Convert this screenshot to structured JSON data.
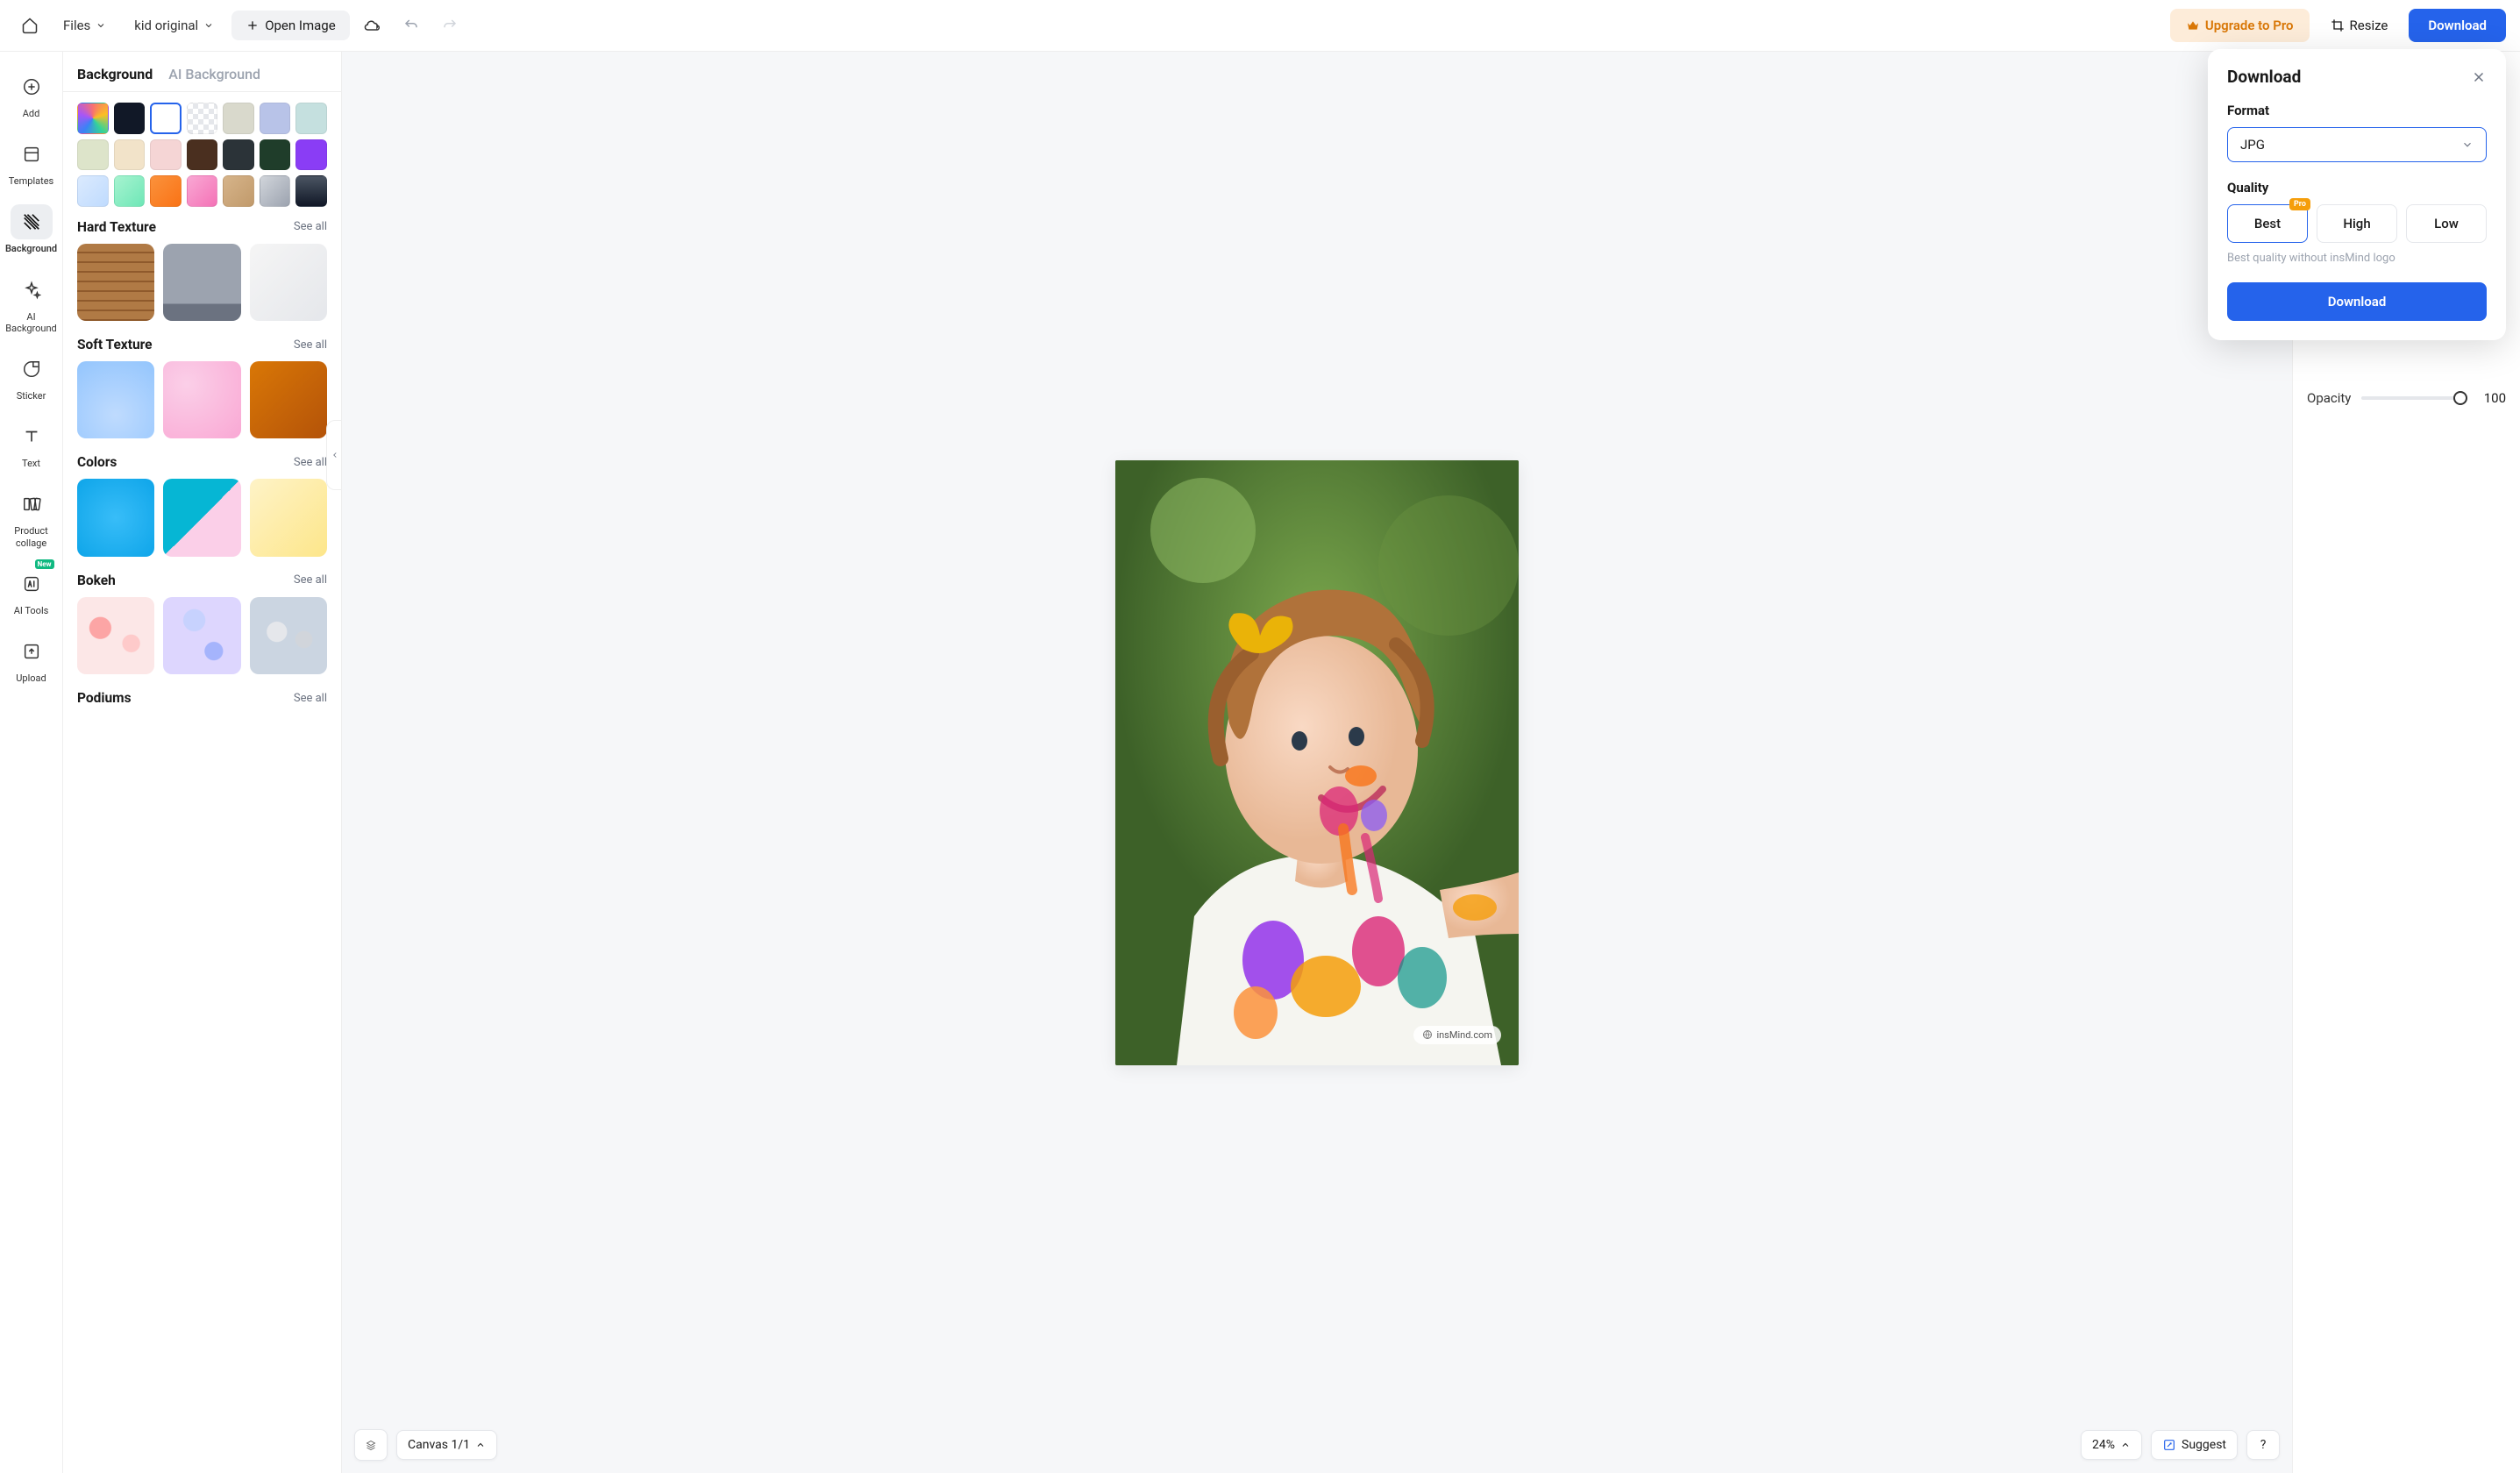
{
  "topbar": {
    "files": "Files",
    "filename": "kid original",
    "open_image": "Open Image",
    "upgrade": "Upgrade to Pro",
    "resize": "Resize",
    "download": "Download"
  },
  "rail": {
    "add": "Add",
    "templates": "Templates",
    "background": "Background",
    "ai_background": "AI Background",
    "sticker": "Sticker",
    "text": "Text",
    "product_collage": "Product collage",
    "ai_tools": "AI Tools",
    "ai_tools_badge": "New",
    "upload": "Upload"
  },
  "sidepanel": {
    "tab_background": "Background",
    "tab_ai_background": "AI Background",
    "swatches": [
      {
        "style": "background: conic-gradient(#f87171,#fbbf24,#34d399,#3b82f6,#a855f7,#f87171)"
      },
      {
        "style": "background:#111827"
      },
      {
        "style": "background:#ffffff",
        "selected": true
      },
      {
        "style": "background:repeating-conic-gradient(#e5e7eb 0 25%, #fff 0 50%); background-size:12px 12px"
      },
      {
        "style": "background:#d9d9cc"
      },
      {
        "style": "background:#b8c3e8"
      },
      {
        "style": "background:#c5e0df"
      },
      {
        "style": "background:#dde4ca"
      },
      {
        "style": "background:#f2e3c9"
      },
      {
        "style": "background:#f5d5d5"
      },
      {
        "style": "background:#4a2f1f"
      },
      {
        "style": "background:#2b3338"
      },
      {
        "style": "background:#1f3d2a"
      },
      {
        "style": "background:#8a3df5"
      },
      {
        "style": "background:linear-gradient(135deg,#dbeafe,#bfdbfe)"
      },
      {
        "style": "background:linear-gradient(135deg,#a7f3d0,#6ee7b7)"
      },
      {
        "style": "background:linear-gradient(135deg,#fb923c,#f97316)"
      },
      {
        "style": "background:linear-gradient(135deg,#f9a8d4,#f472b6)"
      },
      {
        "style": "background:linear-gradient(135deg,#d6b48a,#c19a6b)"
      },
      {
        "style": "background:linear-gradient(135deg,#d1d5db,#9ca3af)"
      },
      {
        "style": "background:linear-gradient(180deg,#4b5563,#111827)"
      }
    ],
    "sections": [
      {
        "title": "Hard Texture",
        "see_all": "See all",
        "thumbs": [
          {
            "style": "background:repeating-linear-gradient(180deg,#b07a45 0 9px,#8f5a2c 9px 11px)"
          },
          {
            "style": "background:linear-gradient(180deg,#9ca3af 0%,#9ca3af 78%,#6b7280 78%,#6b7280 100%)"
          },
          {
            "style": "background:linear-gradient(135deg,#f5f5f5,#e5e7eb)"
          }
        ]
      },
      {
        "title": "Soft Texture",
        "see_all": "See all",
        "thumbs": [
          {
            "style": "background:radial-gradient(circle at 50% 70%,#bfdbfe,#93c5fd)"
          },
          {
            "style": "background:radial-gradient(ellipse at 30% 30%,#fbcfe8,#f9a8d4)"
          },
          {
            "style": "background:linear-gradient(135deg,#d97706,#b45309)"
          }
        ]
      },
      {
        "title": "Colors",
        "see_all": "See all",
        "thumbs": [
          {
            "style": "background:radial-gradient(circle,#38bdf8,#0ea5e9)"
          },
          {
            "style": "background:linear-gradient(135deg,#06b6d4 50%,#fbcfe8 50%)"
          },
          {
            "style": "background:linear-gradient(135deg,#fef3c7,#fde68a)"
          }
        ]
      },
      {
        "title": "Bokeh",
        "see_all": "See all",
        "thumbs": [
          {
            "style": "background:radial-gradient(circle at 30% 40%,#fca5a5 15%,transparent 16%),radial-gradient(circle at 70% 60%,#fecaca 12%,transparent 13%),#fce7e7"
          },
          {
            "style": "background:radial-gradient(circle at 40% 30%,#c7d2fe 15%,transparent 16%),radial-gradient(circle at 65% 70%,#a5b4fc 12%,transparent 13%),#ddd6fe"
          },
          {
            "style": "background:radial-gradient(circle at 35% 45%,#e5e7eb 15%,transparent 16%),radial-gradient(circle at 70% 55%,#d1d5db 12%,transparent 13%),#cbd5e1"
          }
        ]
      },
      {
        "title": "Podiums",
        "see_all": "See all",
        "thumbs": []
      }
    ]
  },
  "canvas": {
    "watermark": "insMind.com",
    "canvas_label": "Canvas 1/1",
    "zoom": "24%",
    "suggest": "Suggest",
    "help": "?"
  },
  "rightpanel": {
    "opacity_label": "Opacity",
    "opacity_value": "100"
  },
  "download_popover": {
    "title": "Download",
    "format_label": "Format",
    "format_value": "JPG",
    "quality_label": "Quality",
    "quality_options": [
      {
        "label": "Best",
        "selected": true,
        "pro": true
      },
      {
        "label": "High"
      },
      {
        "label": "Low"
      }
    ],
    "pro_tag": "Pro",
    "note": "Best quality without insMind logo",
    "confirm": "Download"
  }
}
